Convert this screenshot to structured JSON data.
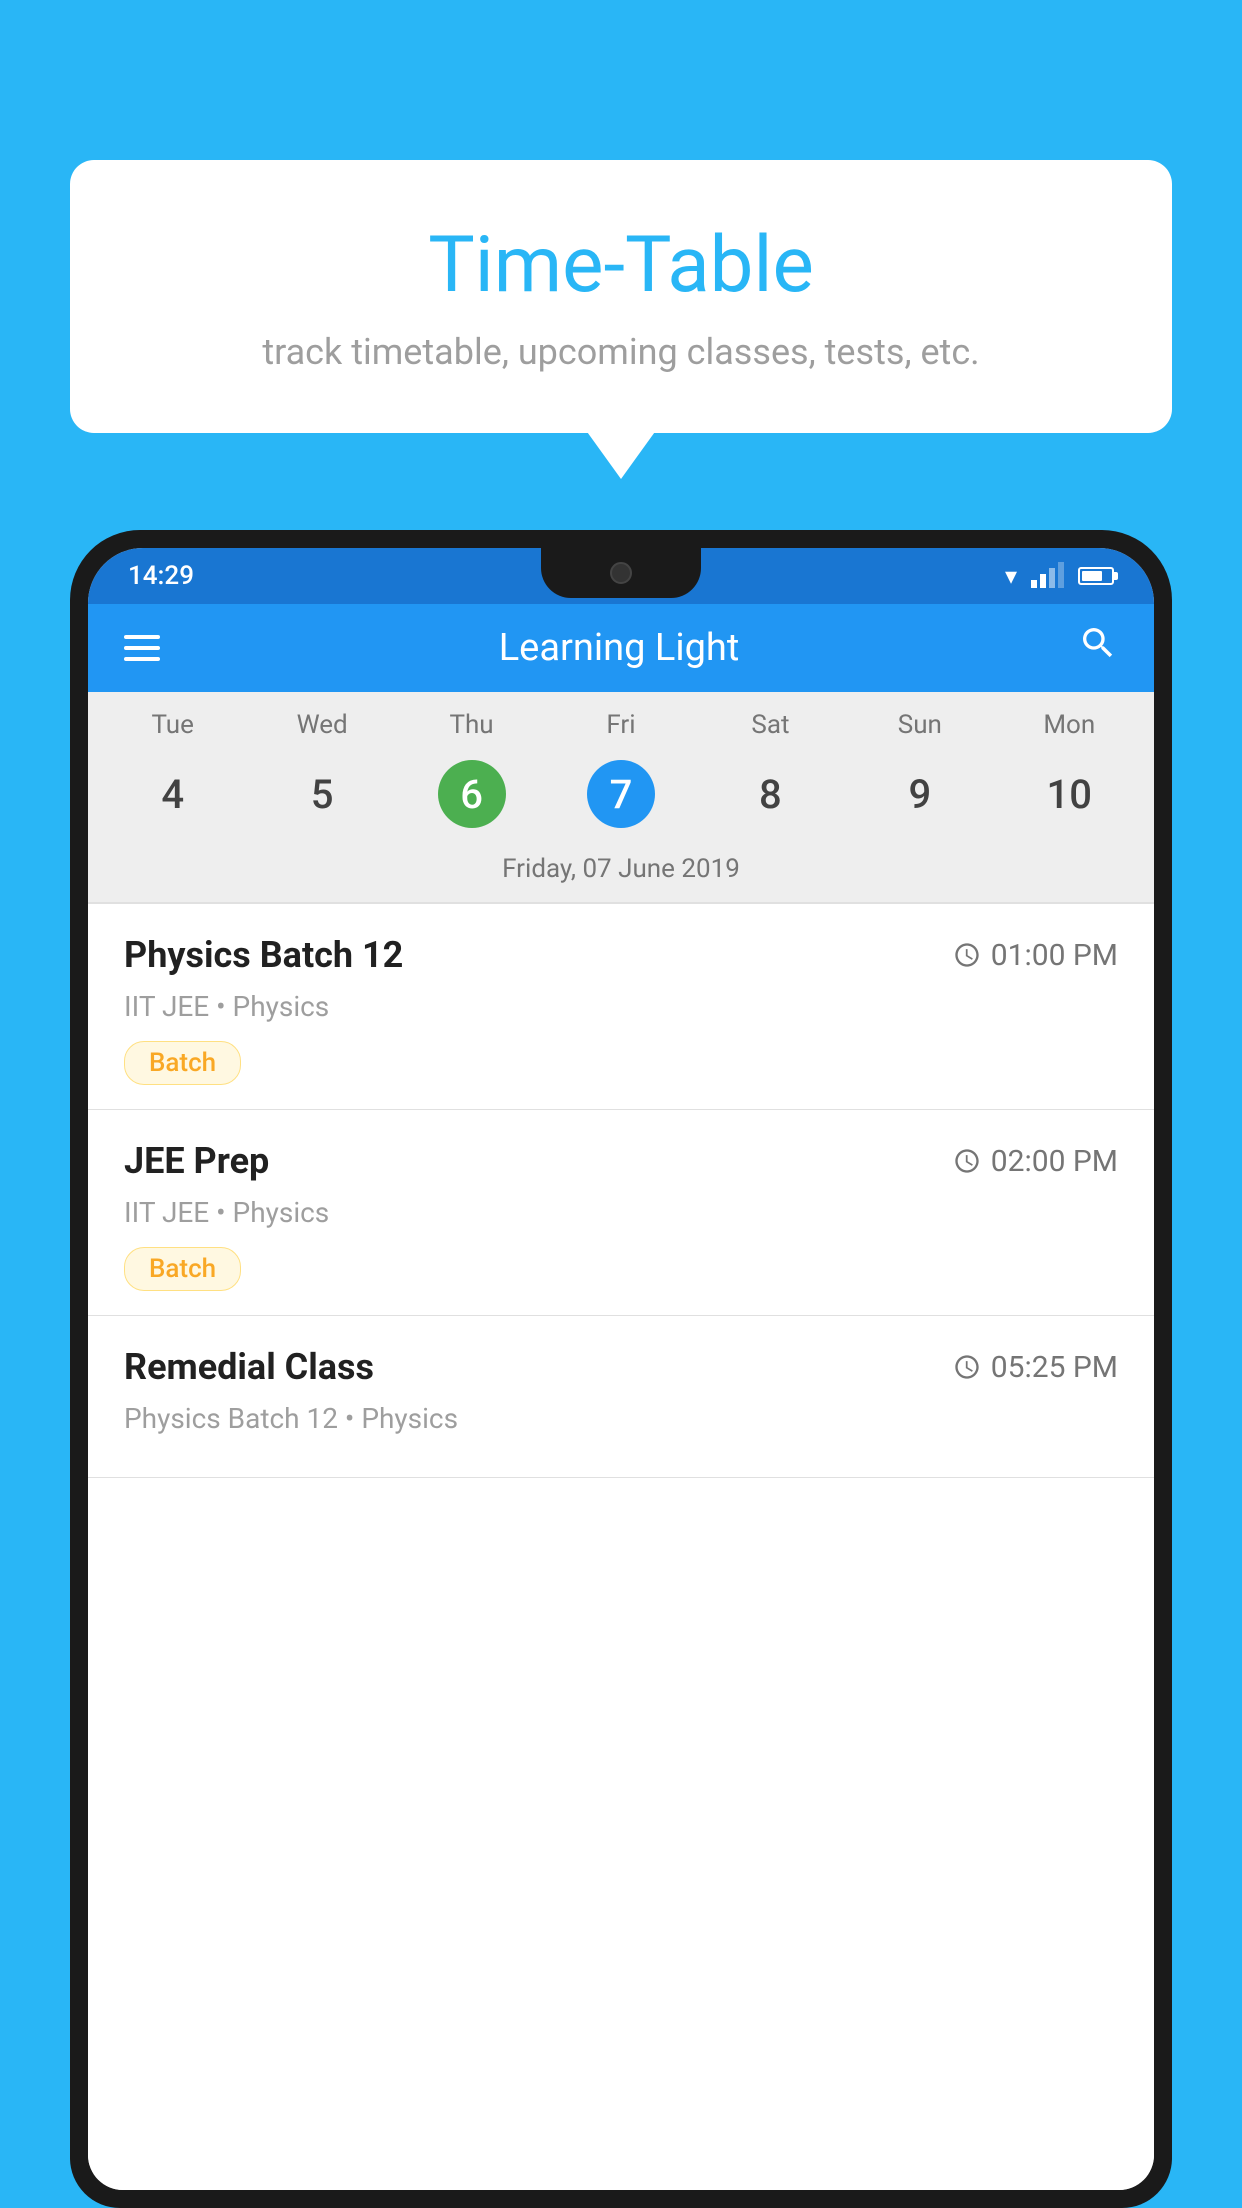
{
  "background_color": "#29b6f6",
  "speech_bubble": {
    "title": "Time-Table",
    "subtitle": "track timetable, upcoming classes, tests, etc."
  },
  "status_bar": {
    "time": "14:29"
  },
  "app_toolbar": {
    "title": "Learning Light",
    "search_label": "Search"
  },
  "calendar": {
    "days_of_week": [
      "Tue",
      "Wed",
      "Thu",
      "Fri",
      "Sat",
      "Sun",
      "Mon"
    ],
    "day_numbers": [
      "4",
      "5",
      "6",
      "7",
      "8",
      "9",
      "10"
    ],
    "today_index": 2,
    "selected_index": 3,
    "selected_date_label": "Friday, 07 June 2019"
  },
  "schedule_items": [
    {
      "title": "Physics Batch 12",
      "time": "01:00 PM",
      "subtitle": "IIT JEE • Physics",
      "tag": "Batch"
    },
    {
      "title": "JEE Prep",
      "time": "02:00 PM",
      "subtitle": "IIT JEE • Physics",
      "tag": "Batch"
    },
    {
      "title": "Remedial Class",
      "time": "05:25 PM",
      "subtitle": "Physics Batch 12 • Physics",
      "tag": ""
    }
  ]
}
